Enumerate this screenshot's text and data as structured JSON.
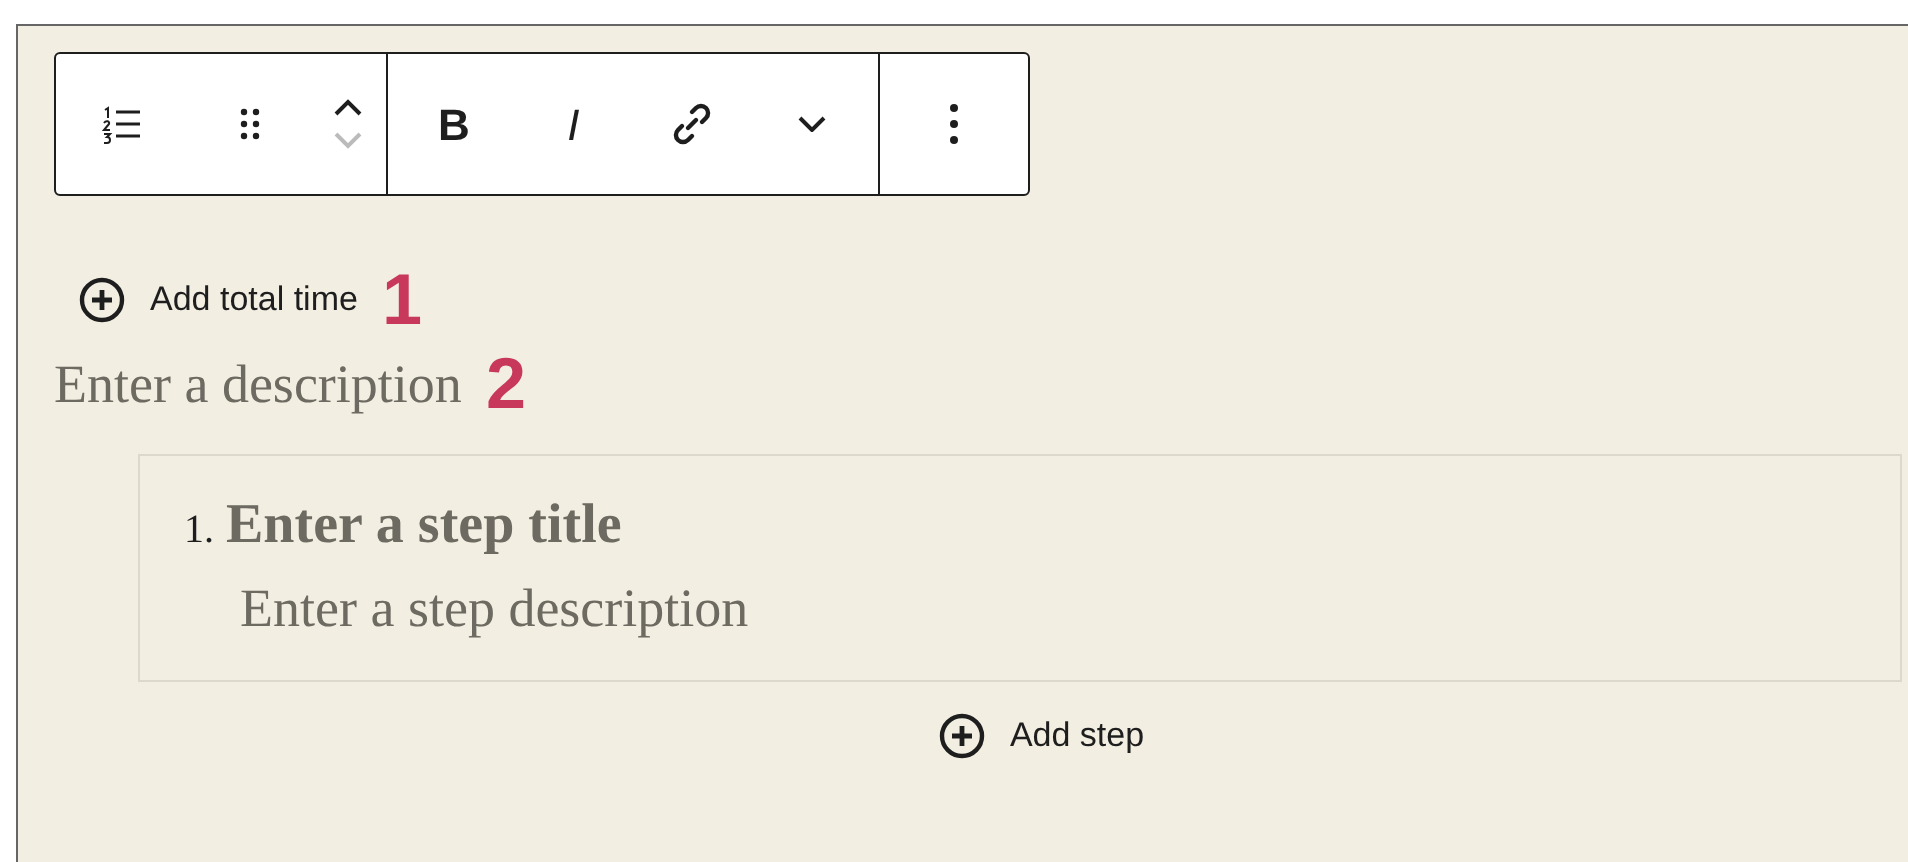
{
  "toolbar": {
    "groups": [
      {
        "buttons": [
          {
            "kind": "list",
            "disabled": false
          },
          {
            "kind": "drag",
            "disabled": false
          },
          {
            "kind": "mover",
            "up_disabled": false,
            "down_disabled": true
          }
        ]
      },
      {
        "buttons": [
          {
            "kind": "bold",
            "label": "B",
            "disabled": false
          },
          {
            "kind": "italic",
            "label": "I",
            "disabled": false
          },
          {
            "kind": "link",
            "disabled": false
          },
          {
            "kind": "chevron",
            "disabled": false
          }
        ]
      },
      {
        "buttons": [
          {
            "kind": "more",
            "disabled": false
          }
        ]
      }
    ]
  },
  "add_total_time": {
    "label": "Add total time",
    "annotation": "1"
  },
  "description": {
    "placeholder": "Enter a description",
    "annotation": "2"
  },
  "steps": [
    {
      "number": "1.",
      "title_placeholder": "Enter a step title",
      "description_placeholder": "Enter a step description"
    }
  ],
  "add_step": {
    "label": "Add step"
  }
}
